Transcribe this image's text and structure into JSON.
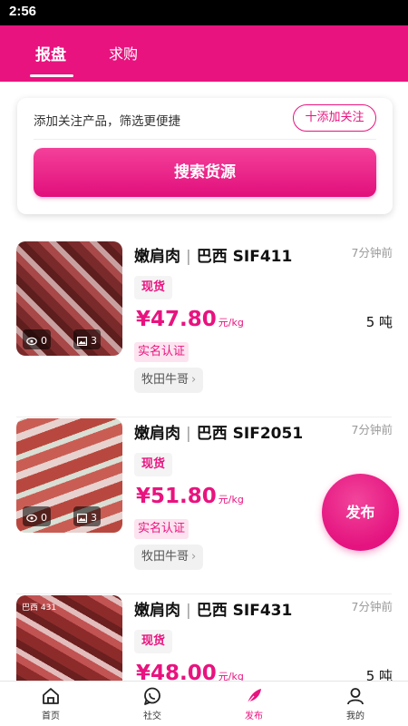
{
  "status_bar": {
    "time": "2:56"
  },
  "header": {
    "tabs": [
      {
        "label": "报盘",
        "active": true
      },
      {
        "label": "求购",
        "active": false
      }
    ]
  },
  "filter": {
    "text": "添加关注产品，筛选更便捷",
    "follow_button": "十添加关注",
    "search_button": "搜索货源"
  },
  "listings": [
    {
      "title": "嫩肩肉",
      "origin": "巴西 SIF411",
      "time": "7分钟前",
      "tag": "现货",
      "price": "¥47.80",
      "price_unit": "元/kg",
      "quantity": "5 吨",
      "verified": "实名认证",
      "seller": "牧田牛哥",
      "views": "0",
      "images": "3"
    },
    {
      "title": "嫩肩肉",
      "origin": "巴西 SIF2051",
      "time": "7分钟前",
      "tag": "现货",
      "price": "¥51.80",
      "price_unit": "元/kg",
      "quantity": "",
      "verified": "实名认证",
      "seller": "牧田牛哥",
      "views": "0",
      "images": "3"
    },
    {
      "title": "嫩肩肉",
      "origin": "巴西 SIF431",
      "time": "7分钟前",
      "tag": "现货",
      "price": "¥48.00",
      "price_unit": "元/kg",
      "quantity": "5 吨",
      "thumb_label": "巴西 431"
    }
  ],
  "fab": {
    "label": "发布"
  },
  "bottom_nav": [
    {
      "label": "首页",
      "icon": "home-icon",
      "active": false
    },
    {
      "label": "社交",
      "icon": "chat-icon",
      "active": false
    },
    {
      "label": "发布",
      "icon": "feather-icon",
      "active": true
    },
    {
      "label": "我的",
      "icon": "user-icon",
      "active": false
    }
  ],
  "colors": {
    "brand": "#e8137f",
    "verified_bg": "#fde3ef"
  }
}
